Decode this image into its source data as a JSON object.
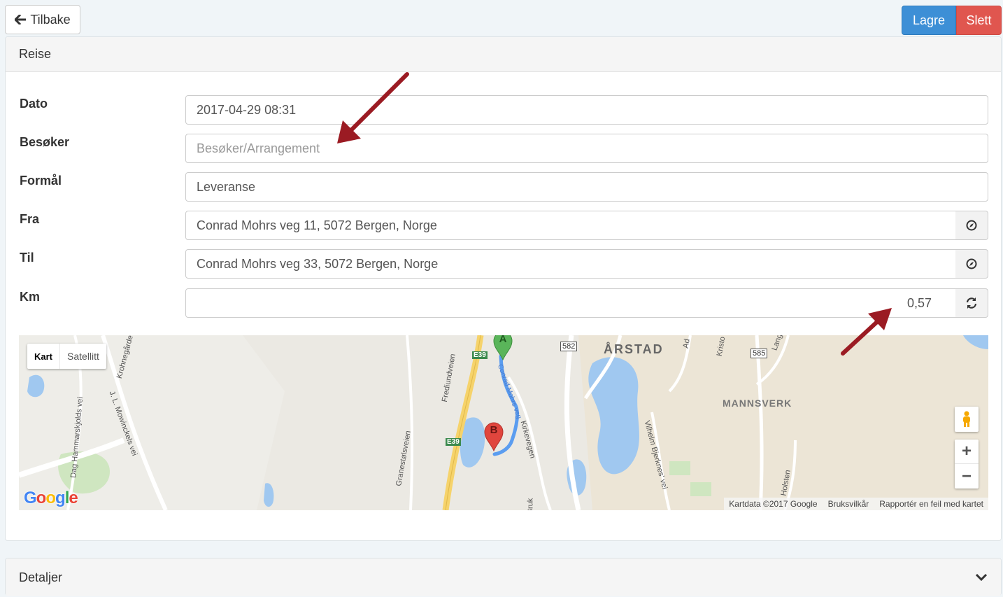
{
  "toolbar": {
    "back_label": "Tilbake",
    "save_label": "Lagre",
    "delete_label": "Slett"
  },
  "trip_panel": {
    "title": "Reise",
    "fields": {
      "date": {
        "label": "Dato",
        "value": "2017-04-29 08:31"
      },
      "visitor": {
        "label": "Besøker",
        "value": "",
        "placeholder": "Besøker/Arrangement"
      },
      "purpose": {
        "label": "Formål",
        "value": "Leveranse"
      },
      "from": {
        "label": "Fra",
        "value": "Conrad Mohrs veg 11, 5072 Bergen, Norge"
      },
      "to": {
        "label": "Til",
        "value": "Conrad Mohrs veg 33, 5072 Bergen, Norge"
      },
      "km": {
        "label": "Km",
        "value": "0,57"
      }
    }
  },
  "map": {
    "type_options": {
      "map": "Kart",
      "satellite": "Satellitt"
    },
    "selected_type": "Kart",
    "place_labels": {
      "arstad": "ÅRSTAD",
      "mannsverk": "MANNSVERK",
      "road_582": "582",
      "road_585": "585",
      "road_e39_top": "E39",
      "road_e39_bottom": "E39",
      "frediundveien": "Frediundveien",
      "kirkevegen": "Kirkevegen",
      "villhelm": "Vilhelm Bjerknes' vei",
      "dag_hammarskjold": "Dag Hammarskjolds vei",
      "mowinckels": "J. L. Mowinckels vei",
      "krohnegarde": "Krohnegårde",
      "granestolsveien": "Granestølsveien",
      "conrad_mohrs_veg": "Conrad Mohrs veg",
      "kristo": "Kristo",
      "ada": "Ad",
      "lang": "Lang",
      "holsten": "Holsten",
      "bruk": "Bruk"
    },
    "marker_a": "A",
    "marker_b": "B",
    "logo": "Google",
    "attribution": {
      "data": "Kartdata ©2017 Google",
      "terms": "Bruksvilkår",
      "report": "Rapportér en feil med kartet"
    },
    "zoom_in": "+",
    "zoom_out": "−"
  },
  "details_panel": {
    "title": "Detaljer"
  },
  "colors": {
    "save": "#3d8fd6",
    "delete": "#e0564f",
    "annotation_arrow": "#9b1b23",
    "route": "#5b9df0",
    "marker_a": "#5ab55a",
    "marker_b": "#e0453d",
    "water": "#a0c8f0"
  }
}
